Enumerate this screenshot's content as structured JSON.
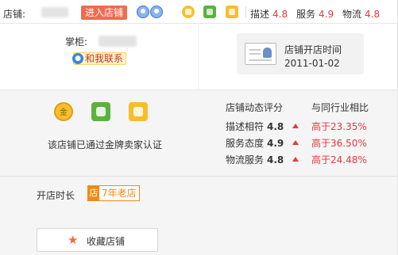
{
  "topbar": {
    "shop_label": "店铺:",
    "enter_shop": "进入店铺",
    "scores": [
      {
        "label": "描述",
        "value": "4.8"
      },
      {
        "label": "服务",
        "value": "4.9"
      },
      {
        "label": "物流",
        "value": "4.8"
      }
    ]
  },
  "seller": {
    "keeper_label": "掌柜:",
    "contact_label": "和我联系",
    "open_time_label": "店铺开店时间",
    "open_date": "2011-01-02"
  },
  "certification": {
    "gold_icon_char": "金",
    "text": "该店铺已通过金牌卖家认证"
  },
  "ratings": {
    "dynamic_title": "店铺动态评分",
    "compare_title": "与同行业相比",
    "rows": [
      {
        "label": "描述相符",
        "score": "4.8",
        "compare": "高于23.35%"
      },
      {
        "label": "服务态度",
        "score": "4.9",
        "compare": "高于36.50%"
      },
      {
        "label": "物流服务",
        "score": "4.8",
        "compare": "高于24.48%"
      }
    ]
  },
  "shop_age": {
    "label": "开店时长",
    "icon_char": "店",
    "value": "7年老店"
  },
  "favorite": {
    "star": "★",
    "label": "收藏店铺"
  },
  "colors": {
    "accent_red": "#e4393c",
    "enter_button": "#f06c4e",
    "age_orange": "#f28a18"
  }
}
